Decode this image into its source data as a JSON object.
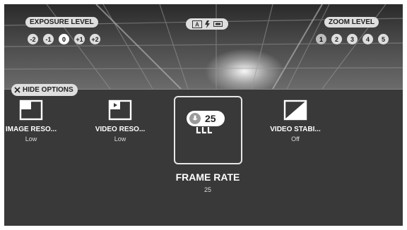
{
  "top_overlay": {
    "exposure_label": "EXPOSURE LEVEL",
    "exposure_values": [
      "-2",
      "-1",
      "0",
      "+1",
      "+2"
    ],
    "exposure_selected": "0",
    "zoom_label": "ZOOM LEVEL",
    "zoom_values": [
      "1",
      "2",
      "3",
      "4",
      "5"
    ],
    "zoom_selected": "1"
  },
  "hide_options_label": "HIDE OPTIONS",
  "options": [
    {
      "title": "IMAGE RESO...",
      "value": "Low",
      "icon": "image-resolution-icon"
    },
    {
      "title": "VIDEO RESO...",
      "value": "Low",
      "icon": "video-resolution-icon"
    },
    {
      "title": "VIDEO STABI...",
      "value": "Off",
      "icon": "video-stabilization-icon"
    }
  ],
  "selected_option": {
    "title": "FRAME RATE",
    "value": "25",
    "badge": "25",
    "icon": "frame-rate-icon"
  },
  "colors": {
    "panel": "#39393a",
    "pill": "#dedede"
  }
}
